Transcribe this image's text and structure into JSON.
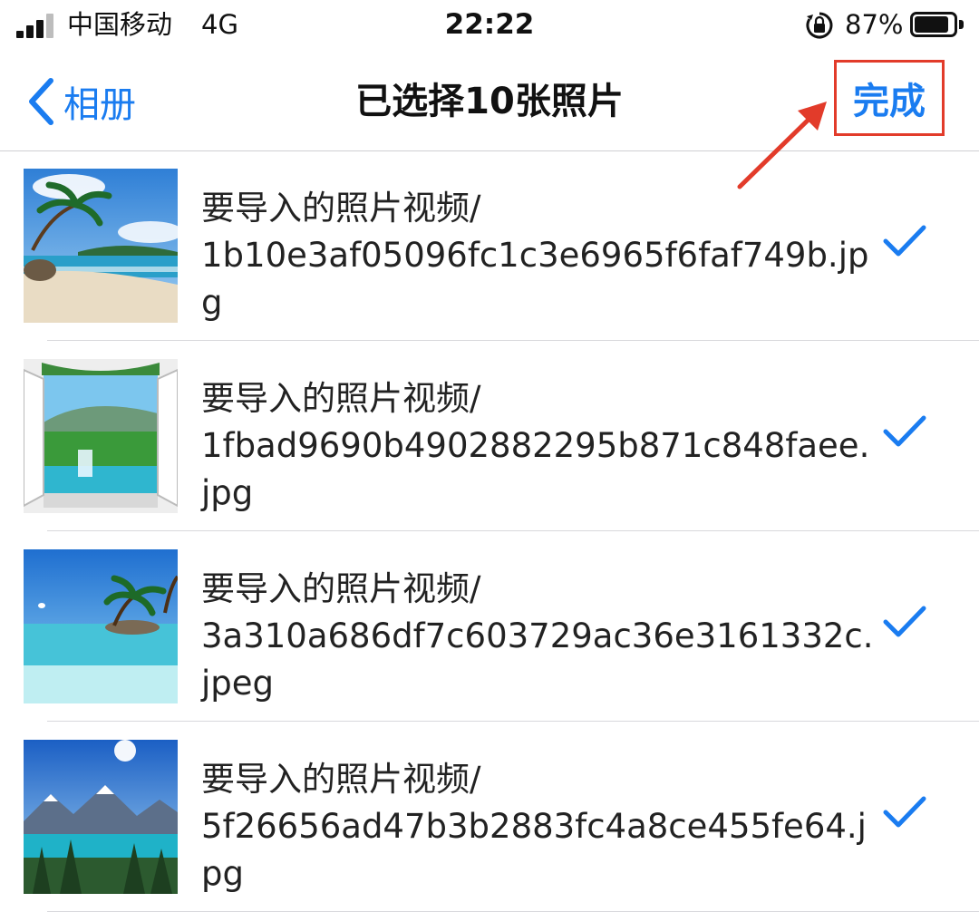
{
  "status_bar": {
    "carrier": "中国移动",
    "network": "4G",
    "time": "22:22",
    "battery_percent_label": "87%",
    "battery_level": 0.87,
    "icons": [
      "signal-icon",
      "orientation-lock-icon",
      "battery-icon"
    ]
  },
  "nav": {
    "back_label": "相册",
    "title": "已选择10张照片",
    "done_label": "完成",
    "accent_color": "#1a7cf0",
    "highlight_color": "#e23b2a"
  },
  "files": [
    {
      "folder": "要导入的照片视频/",
      "name": "1b10e3af05096fc1c3e6965f6faf749b.jpg",
      "selected": true,
      "thumbnail": "beach-palm-thumbnail"
    },
    {
      "folder": "要导入的照片视频/",
      "name": "1fbad9690b4902882295b871c848faee.jpg",
      "selected": true,
      "thumbnail": "window-waterfall-thumbnail"
    },
    {
      "folder": "要导入的照片视频/",
      "name": "3a310a686df7c603729ac36e3161332c.jpeg",
      "selected": true,
      "thumbnail": "tropical-sea-thumbnail"
    },
    {
      "folder": "要导入的照片视频/",
      "name": "5f26656ad47b3b2883fc4a8ce455fe64.jpg",
      "selected": true,
      "thumbnail": "mountain-lake-thumbnail"
    }
  ]
}
